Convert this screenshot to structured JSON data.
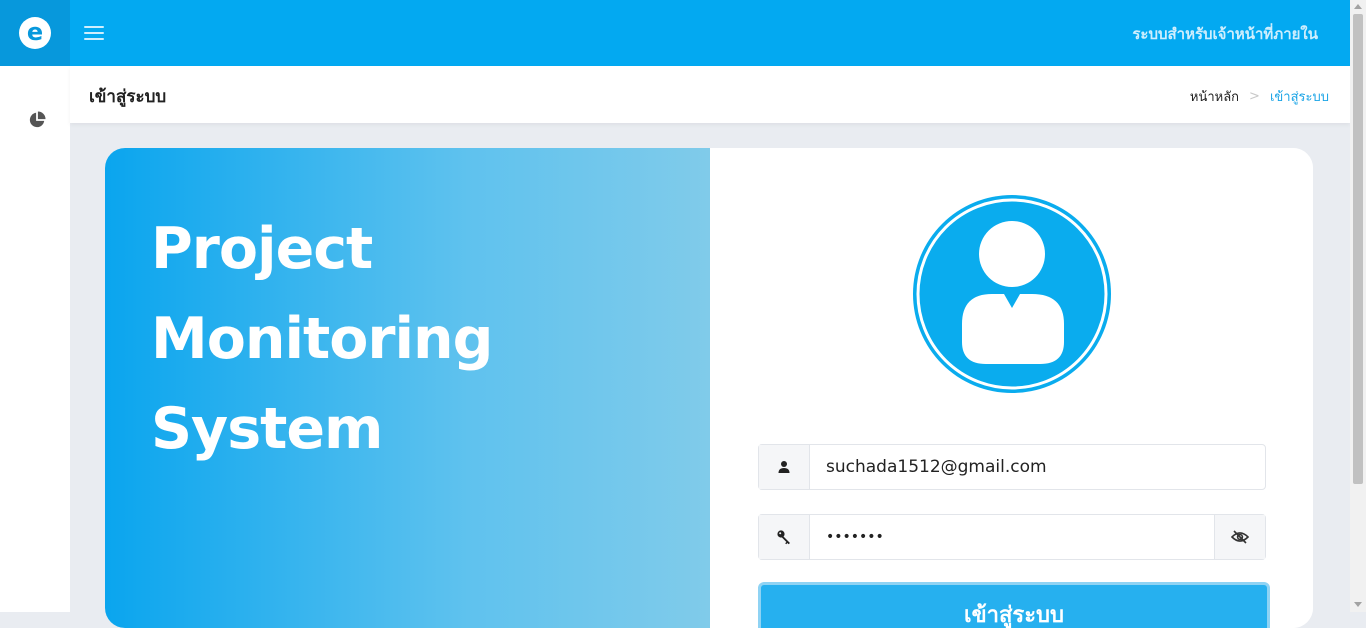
{
  "header": {
    "logo_letter": "e",
    "system_label": "ระบบสำหรับเจ้าหน้าที่ภายใน"
  },
  "page": {
    "title": "เข้าสู่ระบบ",
    "breadcrumb": {
      "home": "หน้าหลัก",
      "separator": ">",
      "current": "เข้าสู่ระบบ"
    }
  },
  "hero": {
    "title_lines": [
      "Project",
      "Monitoring",
      "System"
    ]
  },
  "login_form": {
    "username_value": "suchada1512@gmail.com",
    "password_value": "1234567",
    "submit_label": "เข้าสู่ระบบ"
  },
  "icons": {
    "sidebar": "pie-chart-icon",
    "username": "user-icon",
    "password": "key-icon",
    "toggle_password": "eye-slash-icon",
    "avatar": "user-avatar-icon"
  },
  "colors": {
    "primary": "#03a9f1",
    "logo_bg": "#0798dc",
    "breadcrumb_active": "#1aa4e6",
    "avatar_fill": "#0aacee"
  }
}
